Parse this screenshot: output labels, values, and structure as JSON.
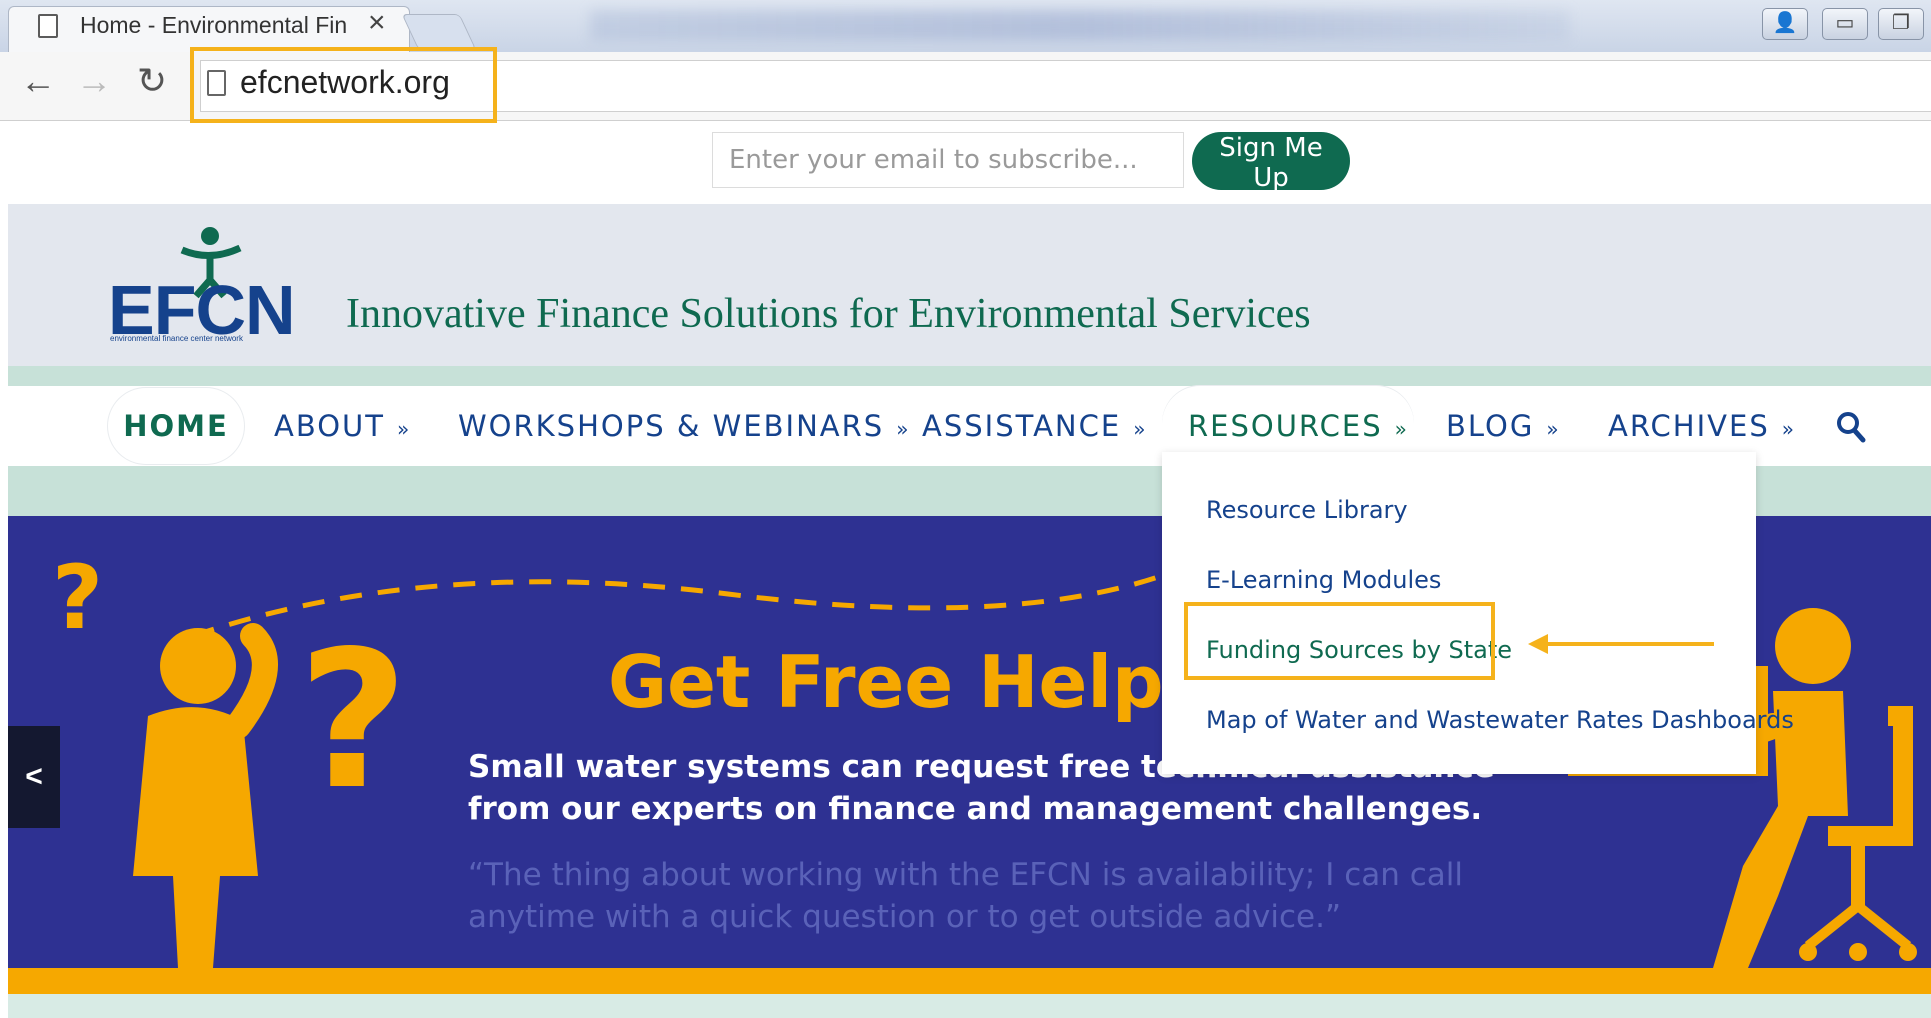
{
  "browser": {
    "tab_title": "Home - Environmental Fin",
    "url": "efcnetwork.org"
  },
  "subscribe": {
    "email_placeholder": "Enter your email to subscribe...",
    "signup_label": "Sign Me Up"
  },
  "header": {
    "logo_text": "EFCN",
    "logo_subtext": "environmental finance center network",
    "tagline": "Innovative Finance Solutions for Environmental Services"
  },
  "nav": {
    "items": [
      {
        "label": "HOME"
      },
      {
        "label": "ABOUT"
      },
      {
        "label": "WORKSHOPS & WEBINARS"
      },
      {
        "label": "ASSISTANCE"
      },
      {
        "label": "RESOURCES"
      },
      {
        "label": "BLOG"
      },
      {
        "label": "ARCHIVES"
      }
    ],
    "chevron": "»",
    "search_icon": "search-icon"
  },
  "dropdown": {
    "items": [
      {
        "label": "Resource Library"
      },
      {
        "label": "E-Learning Modules"
      },
      {
        "label": "Funding Sources by State"
      },
      {
        "label": "Map of Water and Wastewater Rates Dashboards"
      }
    ]
  },
  "hero": {
    "title": "Get Free Help",
    "body": "Small water systems can request free technical assistance from our experts on finance and management challenges.",
    "quote": "“The thing about working with the EFCN is availability; I can call anytime with a quick question or to get outside advice.”",
    "prev_label": "<"
  },
  "colors": {
    "brand_green": "#0f6a50",
    "brand_blue": "#15428c",
    "hero_blue": "#2e3192",
    "accent_orange": "#f6a800",
    "highlight_yellow": "#f5b21b"
  }
}
